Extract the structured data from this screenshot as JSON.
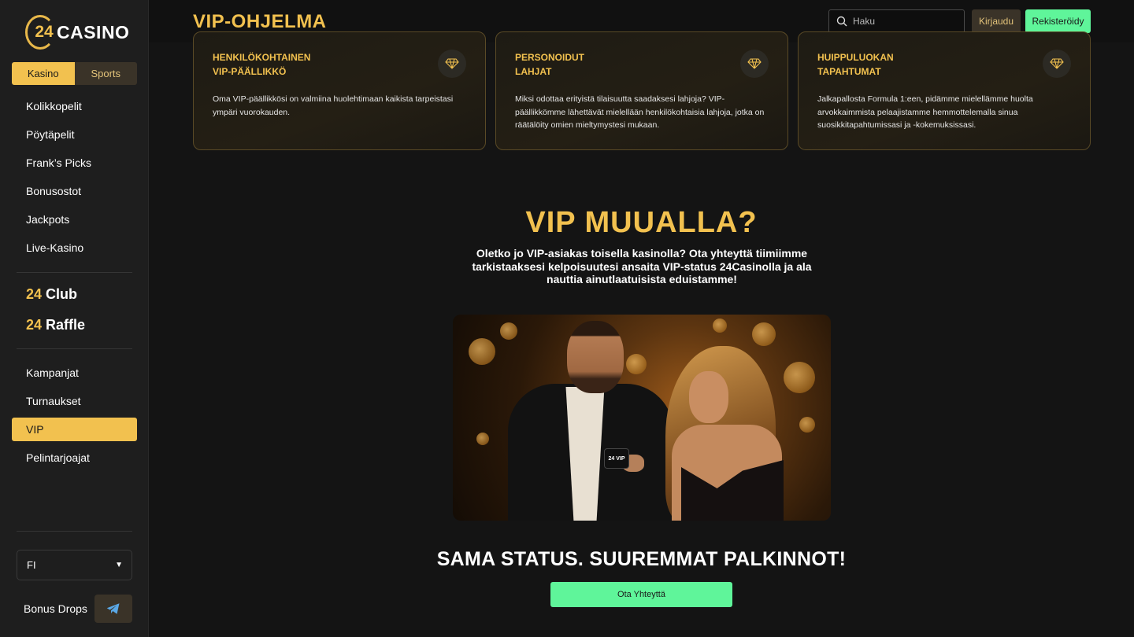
{
  "logo": {
    "number": "24",
    "name": "CASINO"
  },
  "switcher": {
    "kasino": "Kasino",
    "sports": "Sports"
  },
  "nav_main": [
    "Kolikkopelit",
    "Pöytäpelit",
    "Frank’s Picks",
    "Bonusostot",
    "Jackpots",
    "Live-Kasino"
  ],
  "club": {
    "club_num": "24",
    "club_label": "Club",
    "raffle_num": "24",
    "raffle_label": "Raffle"
  },
  "nav_secondary": [
    "Kampanjat",
    "Turnaukset",
    "VIP",
    "Pelintarjoajat"
  ],
  "language": {
    "value": "FI"
  },
  "bonus_drops": "Bonus Drops",
  "header": {
    "title": "VIP-OHJELMA",
    "search_placeholder": "Haku",
    "login": "Kirjaudu",
    "register": "Rekisteröidy"
  },
  "cards": [
    {
      "title": "HENKILÖKOHTAINEN\nVIP-PÄÄLLIKKÖ",
      "text": "Oma VIP-päällikkösi on valmiina huolehtimaan kaikista tarpeistasi ympäri vuorokauden.",
      "icon": "diamond-icon"
    },
    {
      "title": "PERSONOIDUT\nLAHJAT",
      "text": "Miksi odottaa erityistä tilaisuutta saadaksesi lahjoja? VIP-päällikkömme lähettävät mielellään henkilökohtaisia lahjoja, jotka on räätälöity omien mieltymystesi mukaan.",
      "icon": "diamond-icon"
    },
    {
      "title": "HUIPPULUOKAN\nTAPAHTUMAT",
      "text": "Jalkapallosta Formula 1:een, pidämme mielellämme huolta arvokkaimmista pelaajistamme hemmottelemalla sinua suosikkitapahtumissasi ja -kokemuksissasi.",
      "icon": "diamond-icon"
    }
  ],
  "vip_elsewhere": {
    "heading": "VIP MUUALLA?",
    "subtitle": "Oletko jo VIP-asiakas toisella kasinolla? Ota yhteyttä tiimiimme tarkistaaksesi kelpoisuutesi ansaita VIP-status 24Casinolla ja ala nauttia ainutlaatuisista eduistamme!",
    "card_label": "24 VIP",
    "tagline": "SAMA STATUS. SUUREMMAT PALKINNOT!",
    "cta": "Ota Yhteyttä"
  },
  "colors": {
    "accent": "#f2c14f",
    "green": "#5ff59a",
    "background": "#141414",
    "sidebar": "#1e1e1e"
  }
}
